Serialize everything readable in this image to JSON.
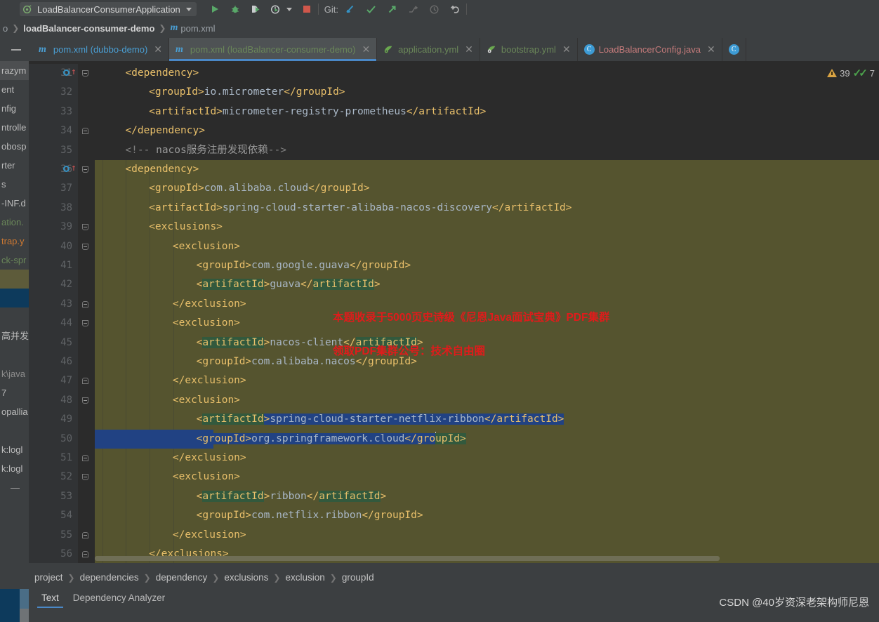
{
  "toolbar": {
    "run_config": "LoadBalancerConsumerApplication",
    "icons": [
      "run-icon",
      "debug-icon",
      "run-with-coverage-icon",
      "profile-icon",
      "stop-icon"
    ],
    "git_label": "Git:",
    "git_icons": [
      "git-update-icon",
      "git-commit-icon",
      "git-push-icon",
      "git-branch-icon",
      "git-history-icon",
      "git-rollback-icon"
    ]
  },
  "navbar": {
    "crumbs": [
      "o",
      "loadBalancer-consumer-demo",
      "pom.xml"
    ]
  },
  "tabs": [
    {
      "label": "pom.xml (dubbo-demo)",
      "icon": "maven-icon",
      "active": false,
      "color": "#4a9fd4"
    },
    {
      "label": "pom.xml (loadBalancer-consumer-demo)",
      "icon": "maven-icon",
      "active": true,
      "color": "#6a8759"
    },
    {
      "label": "application.yml",
      "icon": "spring-yaml-icon",
      "active": false,
      "color": "#6a8759"
    },
    {
      "label": "bootstrap.yml",
      "icon": "spring-yaml-icon",
      "active": false,
      "color": "#6a8759"
    },
    {
      "label": "LoadBalancerConfig.java",
      "icon": "java-class-icon",
      "active": false,
      "color": "#c57b7b"
    }
  ],
  "left_strip_rows": [
    {
      "text": "razym",
      "style": "chip"
    },
    {
      "text": "ent",
      "style": "plain"
    },
    {
      "text": "nfig",
      "style": "plain"
    },
    {
      "text": "ntrolle",
      "style": "plain"
    },
    {
      "text": "obosp",
      "style": "plain"
    },
    {
      "text": "rter",
      "style": "plain"
    },
    {
      "text": "s",
      "style": "plain"
    },
    {
      "text": "-INF.d",
      "style": "plain"
    },
    {
      "text": "ation.",
      "style": "green"
    },
    {
      "text": "trap.y",
      "style": "orange"
    },
    {
      "text": "ck-spr",
      "style": "green"
    },
    {
      "text": "",
      "style": "sel-olive"
    },
    {
      "text": "",
      "style": "sel-blue"
    },
    {
      "text": "",
      "style": "plain"
    },
    {
      "text": "高并发",
      "style": "plain"
    },
    {
      "text": "",
      "style": "plain"
    },
    {
      "text": "k\\java",
      "style": "dim"
    },
    {
      "text": "7",
      "style": "plain"
    },
    {
      "text": "opallia",
      "style": "plain"
    },
    {
      "text": "",
      "style": "plain"
    },
    {
      "text": "k:logl",
      "style": "plain"
    },
    {
      "text": "k:logl",
      "style": "plain"
    },
    {
      "text": "—",
      "style": "dash"
    }
  ],
  "editor": {
    "first_line_number": 31,
    "cursor_line": 50,
    "lines": [
      {
        "n": 31,
        "indent": 2,
        "runmark": true,
        "fold": "open",
        "olive": false,
        "parts": [
          {
            "t": "<dependency>",
            "c": "tg"
          }
        ]
      },
      {
        "n": 32,
        "indent": 3,
        "runmark": false,
        "fold": "",
        "olive": false,
        "parts": [
          {
            "t": "<groupId>",
            "c": "tg"
          },
          {
            "t": "io.micrometer",
            "c": "txtv"
          },
          {
            "t": "</groupId>",
            "c": "tg"
          }
        ]
      },
      {
        "n": 33,
        "indent": 3,
        "runmark": false,
        "fold": "",
        "olive": false,
        "parts": [
          {
            "t": "<artifactId>",
            "c": "tg"
          },
          {
            "t": "micrometer-registry-prometheus",
            "c": "txtv"
          },
          {
            "t": "</artifactId>",
            "c": "tg"
          }
        ]
      },
      {
        "n": 34,
        "indent": 2,
        "runmark": false,
        "fold": "close",
        "olive": false,
        "parts": [
          {
            "t": "</dependency>",
            "c": "tg"
          }
        ]
      },
      {
        "n": 35,
        "indent": 2,
        "runmark": false,
        "fold": "",
        "olive": false,
        "parts": [
          {
            "t": "<!-- ",
            "c": "cmt"
          },
          {
            "t": "nacos服务注册发现依赖",
            "c": "cmt-cn"
          },
          {
            "t": "-->",
            "c": "cmt"
          }
        ]
      },
      {
        "n": 36,
        "indent": 2,
        "runmark": true,
        "fold": "open",
        "olive": true,
        "parts": [
          {
            "t": "<dependency>",
            "c": "tg"
          }
        ]
      },
      {
        "n": 37,
        "indent": 3,
        "runmark": false,
        "fold": "",
        "olive": true,
        "parts": [
          {
            "t": "<groupId>",
            "c": "tg"
          },
          {
            "t": "com.alibaba.cloud",
            "c": "txtv"
          },
          {
            "t": "</groupId>",
            "c": "tg"
          }
        ]
      },
      {
        "n": 38,
        "indent": 3,
        "runmark": false,
        "fold": "",
        "olive": true,
        "parts": [
          {
            "t": "<artifactId>",
            "c": "tg"
          },
          {
            "t": "spring-cloud-starter-alibaba-nacos-discovery",
            "c": "txtv"
          },
          {
            "t": "</artifactId>",
            "c": "tg"
          }
        ]
      },
      {
        "n": 39,
        "indent": 3,
        "runmark": false,
        "fold": "open",
        "olive": true,
        "parts": [
          {
            "t": "<exclusions>",
            "c": "tg"
          }
        ]
      },
      {
        "n": 40,
        "indent": 4,
        "runmark": false,
        "fold": "open",
        "olive": true,
        "parts": [
          {
            "t": "<exclusion>",
            "c": "tg"
          }
        ]
      },
      {
        "n": 41,
        "indent": 5,
        "runmark": false,
        "fold": "",
        "olive": true,
        "parts": [
          {
            "t": "<groupId>",
            "c": "tg"
          },
          {
            "t": "com.google.guava",
            "c": "txtv"
          },
          {
            "t": "</groupId>",
            "c": "tg"
          }
        ]
      },
      {
        "n": 42,
        "indent": 5,
        "runmark": false,
        "fold": "",
        "olive": true,
        "parts": [
          {
            "t": "<",
            "c": "tg"
          },
          {
            "t": "artifactId",
            "c": "tg hl"
          },
          {
            "t": ">",
            "c": "tg"
          },
          {
            "t": "guava",
            "c": "txtv"
          },
          {
            "t": "</",
            "c": "tg"
          },
          {
            "t": "artifactId",
            "c": "tg hl"
          },
          {
            "t": ">",
            "c": "tg"
          }
        ]
      },
      {
        "n": 43,
        "indent": 4,
        "runmark": false,
        "fold": "close",
        "olive": true,
        "parts": [
          {
            "t": "</exclusion>",
            "c": "tg"
          }
        ]
      },
      {
        "n": 44,
        "indent": 4,
        "runmark": false,
        "fold": "open",
        "olive": true,
        "parts": [
          {
            "t": "<exclusion>",
            "c": "tg"
          }
        ]
      },
      {
        "n": 45,
        "indent": 5,
        "runmark": false,
        "fold": "",
        "olive": true,
        "parts": [
          {
            "t": "<",
            "c": "tg"
          },
          {
            "t": "artifactId",
            "c": "tg hl"
          },
          {
            "t": ">",
            "c": "tg"
          },
          {
            "t": "nacos-client",
            "c": "txtv"
          },
          {
            "t": "</",
            "c": "tg"
          },
          {
            "t": "artifactId",
            "c": "tg hl"
          },
          {
            "t": ">",
            "c": "tg"
          }
        ]
      },
      {
        "n": 46,
        "indent": 5,
        "runmark": false,
        "fold": "",
        "olive": true,
        "parts": [
          {
            "t": "<groupId>",
            "c": "tg"
          },
          {
            "t": "com.alibaba.nacos",
            "c": "txtv"
          },
          {
            "t": "</groupId>",
            "c": "tg"
          }
        ]
      },
      {
        "n": 47,
        "indent": 4,
        "runmark": false,
        "fold": "close",
        "olive": true,
        "parts": [
          {
            "t": "</exclusion>",
            "c": "tg"
          }
        ]
      },
      {
        "n": 48,
        "indent": 4,
        "runmark": false,
        "fold": "open",
        "olive": true,
        "parts": [
          {
            "t": "<exclusion>",
            "c": "tg"
          }
        ]
      },
      {
        "n": 49,
        "indent": 5,
        "runmark": false,
        "fold": "",
        "olive": true,
        "rowsel": "partial",
        "parts": [
          {
            "t": "<",
            "c": "tg"
          },
          {
            "t": "artifactId",
            "c": "tg hl"
          },
          {
            "t": ">",
            "c": "tg sel"
          },
          {
            "t": "spring-cloud-starter-netflix-ribbon",
            "c": "txtv sel"
          },
          {
            "t": "</artifactId>",
            "c": "tg sel"
          }
        ]
      },
      {
        "n": 50,
        "indent": 5,
        "runmark": false,
        "fold": "",
        "olive": true,
        "rowsel": "full",
        "parts": [
          {
            "t": "<groupId>",
            "c": "tg sel"
          },
          {
            "t": "org.springframework.cloud",
            "c": "txtv sel"
          },
          {
            "t": "</gro",
            "c": "tg sel"
          },
          {
            "t": "CARET",
            "c": "caret"
          },
          {
            "t": "upId>",
            "c": "tg hl"
          }
        ]
      },
      {
        "n": 51,
        "indent": 4,
        "runmark": false,
        "fold": "close",
        "olive": true,
        "parts": [
          {
            "t": "</exclusion>",
            "c": "tg"
          }
        ]
      },
      {
        "n": 52,
        "indent": 4,
        "runmark": false,
        "fold": "open",
        "olive": true,
        "parts": [
          {
            "t": "<exclusion>",
            "c": "tg"
          }
        ]
      },
      {
        "n": 53,
        "indent": 5,
        "runmark": false,
        "fold": "",
        "olive": true,
        "parts": [
          {
            "t": "<",
            "c": "tg"
          },
          {
            "t": "artifactId",
            "c": "tg hl"
          },
          {
            "t": ">",
            "c": "tg"
          },
          {
            "t": "ribbon",
            "c": "txtv"
          },
          {
            "t": "</",
            "c": "tg"
          },
          {
            "t": "artifactId",
            "c": "tg hl"
          },
          {
            "t": ">",
            "c": "tg"
          }
        ]
      },
      {
        "n": 54,
        "indent": 5,
        "runmark": false,
        "fold": "",
        "olive": true,
        "parts": [
          {
            "t": "<groupId>",
            "c": "tg"
          },
          {
            "t": "com.netflix.ribbon",
            "c": "txtv"
          },
          {
            "t": "</groupId>",
            "c": "tg"
          }
        ]
      },
      {
        "n": 55,
        "indent": 4,
        "runmark": false,
        "fold": "close",
        "olive": true,
        "parts": [
          {
            "t": "</exclusion>",
            "c": "tg"
          }
        ]
      },
      {
        "n": 56,
        "indent": 3,
        "runmark": false,
        "fold": "close",
        "olive": true,
        "parts": [
          {
            "t": "</exclusions>",
            "c": "tg"
          }
        ]
      }
    ],
    "inspections": {
      "warning_count": "39",
      "ok_count": "7"
    }
  },
  "watermark": {
    "line1": "本题收录于5000页史诗级《尼恩Java面试宝典》PDF集群",
    "line2": "领取PDF集群公号：技术自由圈",
    "color": "#e01b1b"
  },
  "xml_breadcrumb": [
    "project",
    "dependencies",
    "dependency",
    "exclusions",
    "exclusion",
    "groupId"
  ],
  "bottom_tabs": [
    {
      "label": "Text",
      "active": true
    },
    {
      "label": "Dependency Analyzer",
      "active": false
    }
  ],
  "csdn_watermark": "CSDN @40岁资深老架构师尼恩"
}
